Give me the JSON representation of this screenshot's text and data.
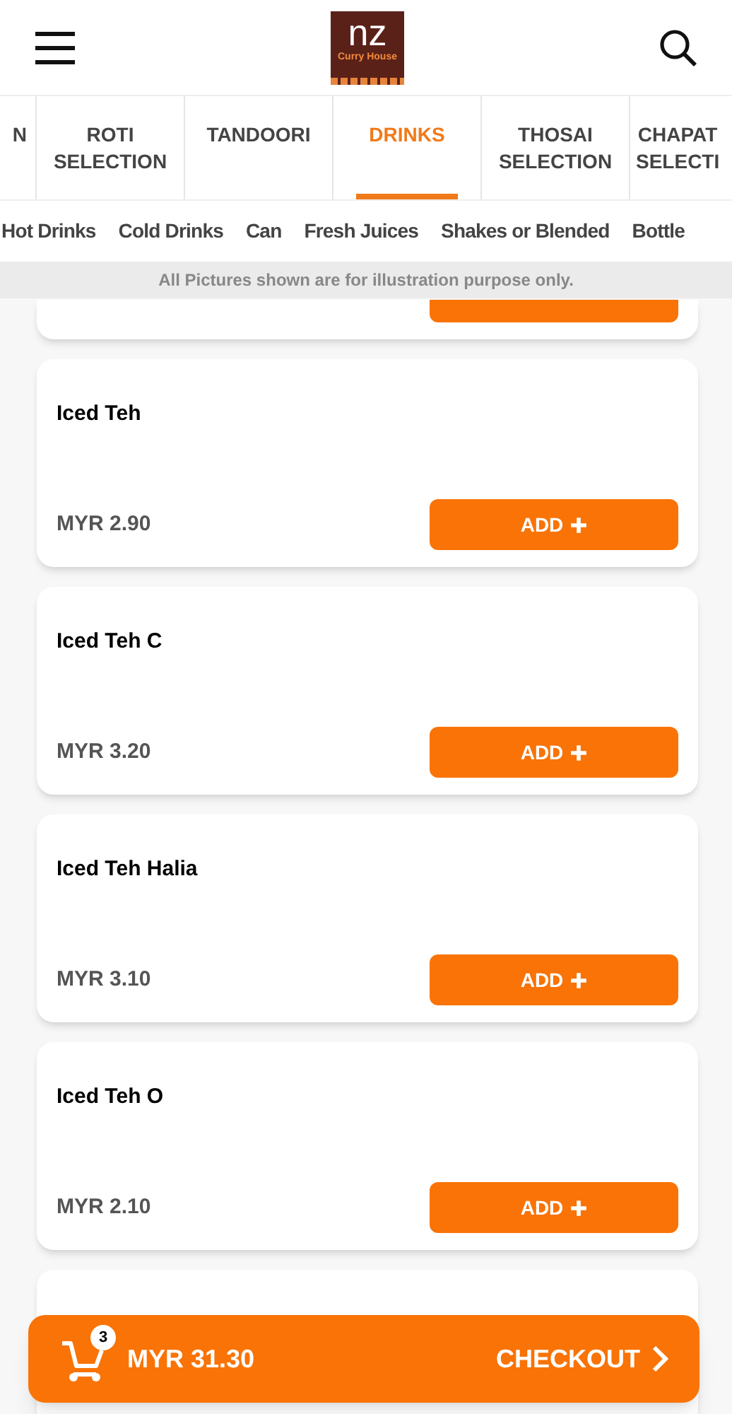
{
  "header": {
    "logo_text": "nz",
    "logo_subtext": "Curry House"
  },
  "categories": [
    {
      "label": "N",
      "selected": false
    },
    {
      "label": "ROTI SELECTION",
      "selected": false
    },
    {
      "label": "TANDOORI",
      "selected": false
    },
    {
      "label": "DRINKS",
      "selected": true
    },
    {
      "label": "THOSAI SELECTION",
      "selected": false
    },
    {
      "label": "CHAPAT SELECTI",
      "selected": false
    }
  ],
  "subcategories": [
    "Hot Drinks",
    "Cold Drinks",
    "Can",
    "Fresh Juices",
    "Shakes or Blended",
    "Bottle"
  ],
  "notice": "All Pictures shown are for illustration purpose only.",
  "items": [
    {
      "name": "Iced Teh",
      "price": "MYR 2.90",
      "button": "ADD"
    },
    {
      "name": "Iced Teh C",
      "price": "MYR 3.20",
      "button": "ADD"
    },
    {
      "name": "Iced Teh Halia",
      "price": "MYR 3.10",
      "button": "ADD"
    },
    {
      "name": "Iced Teh O",
      "price": "MYR 2.10",
      "button": "ADD"
    }
  ],
  "cart": {
    "count": "3",
    "total": "MYR 31.30",
    "checkout": "CHECKOUT"
  }
}
